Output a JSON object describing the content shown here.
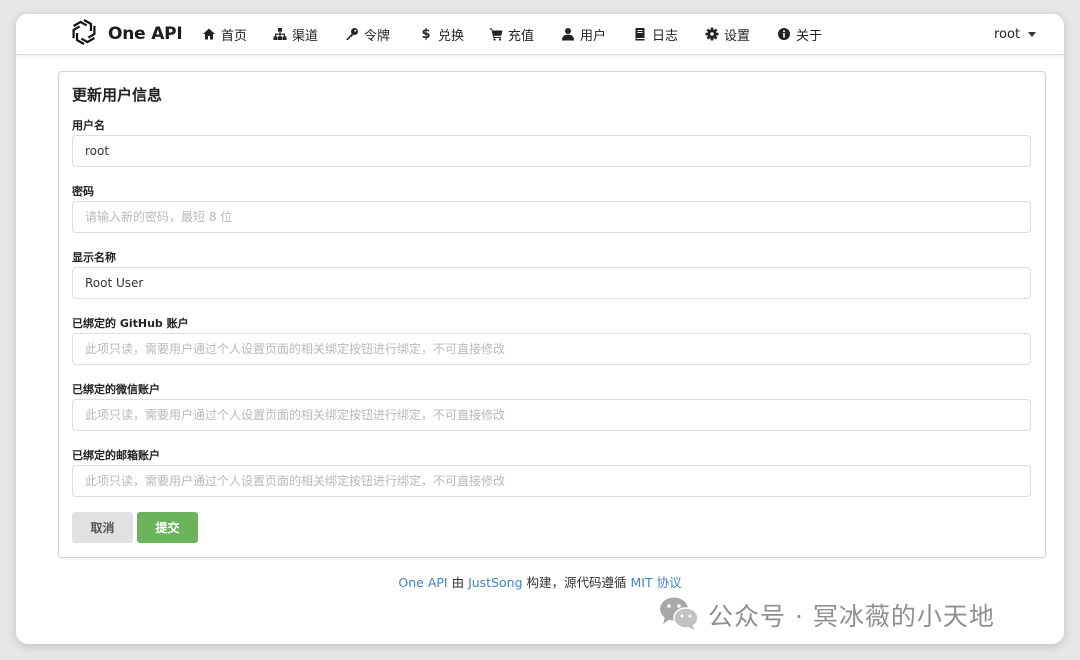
{
  "brand": {
    "name": "One API"
  },
  "nav": {
    "items": [
      {
        "label": "首页",
        "icon": "home-icon"
      },
      {
        "label": "渠道",
        "icon": "sitemap-icon"
      },
      {
        "label": "令牌",
        "icon": "key-icon"
      },
      {
        "label": "兑换",
        "icon": "dollar-icon"
      },
      {
        "label": "充值",
        "icon": "cart-icon"
      },
      {
        "label": "用户",
        "icon": "user-icon"
      },
      {
        "label": "日志",
        "icon": "book-icon"
      },
      {
        "label": "设置",
        "icon": "gear-icon"
      },
      {
        "label": "关于",
        "icon": "info-circle-icon"
      }
    ],
    "user": "root"
  },
  "form": {
    "title": "更新用户信息",
    "username": {
      "label": "用户名",
      "value": "root"
    },
    "password": {
      "label": "密码",
      "placeholder": "请输入新的密码，最短 8 位"
    },
    "display_name": {
      "label": "显示名称",
      "value": "Root User"
    },
    "github": {
      "label": "已绑定的 GitHub 账户",
      "placeholder": "此项只读，需要用户通过个人设置页面的相关绑定按钮进行绑定，不可直接修改"
    },
    "wechat": {
      "label": "已绑定的微信账户",
      "placeholder": "此项只读，需要用户通过个人设置页面的相关绑定按钮进行绑定，不可直接修改"
    },
    "email": {
      "label": "已绑定的邮箱账户",
      "placeholder": "此项只读，需要用户通过个人设置页面的相关绑定按钮进行绑定，不可直接修改"
    },
    "cancel_label": "取消",
    "submit_label": "提交"
  },
  "footer": {
    "project": "One API",
    "by": " 由 ",
    "author": "JustSong",
    "middle": " 构建，源代码遵循 ",
    "license": "MIT 协议"
  },
  "watermark": {
    "text": "公众号 · 冥冰薇的小天地",
    "icon": "wechat-icon"
  },
  "colors": {
    "submit": "#6cb45b",
    "cancel": "#e0e1e2",
    "link": "#4183c4"
  }
}
